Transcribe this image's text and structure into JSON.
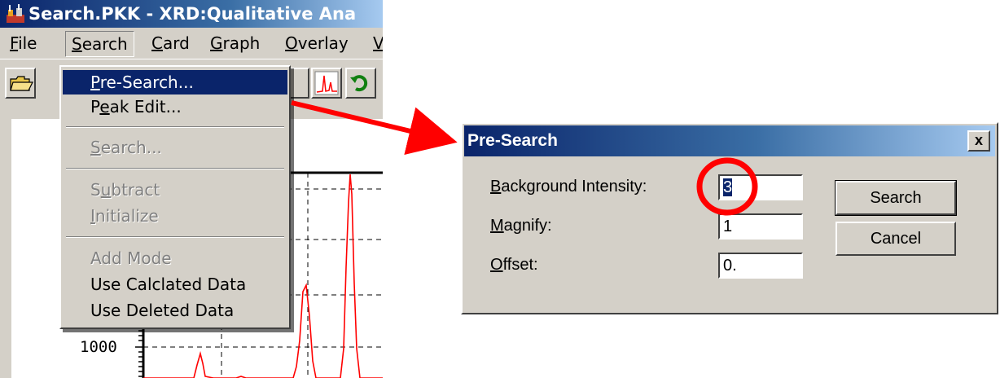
{
  "app": {
    "title": "Search.PKK - XRD:Qualitative Ana",
    "menu": [
      "File",
      "Search",
      "Card",
      "Graph",
      "Overlay",
      "V"
    ],
    "active_menu": "Search"
  },
  "search_menu": {
    "items": [
      {
        "label": "Pre-Search...",
        "state": "selected"
      },
      {
        "label": "Peak Edit...",
        "state": "enabled"
      },
      {
        "label": "Search...",
        "state": "disabled"
      },
      {
        "label": "Subtract",
        "state": "disabled"
      },
      {
        "label": "Initialize",
        "state": "disabled"
      },
      {
        "label": "Add Mode",
        "state": "disabled"
      },
      {
        "label": "Use Calclated Data",
        "state": "enabled"
      },
      {
        "label": "Use Deleted Data",
        "state": "enabled"
      }
    ]
  },
  "graph": {
    "y_tick_label": "1000",
    "line_color": "#ff0000"
  },
  "dialog": {
    "title": "Pre-Search",
    "close_glyph": "x",
    "fields": [
      {
        "label": "Background Intensity:",
        "value": "3"
      },
      {
        "label": "Magnify:",
        "value": "1"
      },
      {
        "label": "Offset:",
        "value": "0."
      }
    ],
    "search_button": "Search",
    "cancel_button": "Cancel"
  },
  "annotation": {
    "color": "#ff0000"
  }
}
